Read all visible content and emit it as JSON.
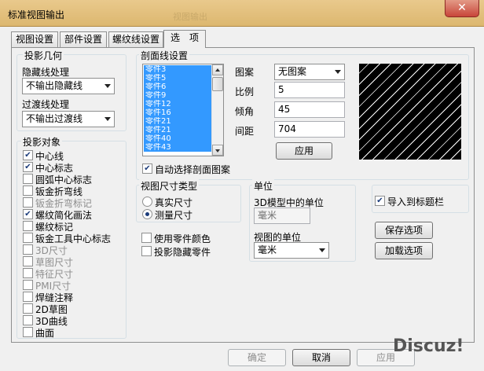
{
  "window": {
    "title": "标准视图输出",
    "ghost_title": "视图输出"
  },
  "tabs": [
    {
      "label": "视图设置"
    },
    {
      "label": "部件设置"
    },
    {
      "label": "螺纹线设置"
    },
    {
      "label": "选　项"
    }
  ],
  "projection_geometry": {
    "title": "投影几何",
    "hidden_label": "隐藏线处理",
    "hidden_value": "不输出隐藏线",
    "transition_label": "过渡线处理",
    "transition_value": "不输出过渡线"
  },
  "projection_objects": {
    "title": "投影对象",
    "items": [
      {
        "label": "中心线",
        "checked": true,
        "enabled": true
      },
      {
        "label": "中心标志",
        "checked": true,
        "enabled": true
      },
      {
        "label": "圆弧中心标志",
        "checked": false,
        "enabled": true
      },
      {
        "label": "钣金折弯线",
        "checked": false,
        "enabled": true
      },
      {
        "label": "钣金折弯标记",
        "checked": false,
        "enabled": false
      },
      {
        "label": "螺纹简化画法",
        "checked": true,
        "enabled": true
      },
      {
        "label": "螺纹标记",
        "checked": false,
        "enabled": true
      },
      {
        "label": "钣金工具中心标志",
        "checked": false,
        "enabled": true
      },
      {
        "label": "3D尺寸",
        "checked": false,
        "enabled": false
      },
      {
        "label": "草图尺寸",
        "checked": false,
        "enabled": false
      },
      {
        "label": "特征尺寸",
        "checked": false,
        "enabled": false
      },
      {
        "label": "PMI尺寸",
        "checked": false,
        "enabled": false
      },
      {
        "label": "焊缝注释",
        "checked": false,
        "enabled": true
      },
      {
        "label": "2D草图",
        "checked": false,
        "enabled": true
      },
      {
        "label": "3D曲线",
        "checked": false,
        "enabled": true
      },
      {
        "label": "曲面",
        "checked": false,
        "enabled": true
      }
    ]
  },
  "section_lines": {
    "title": "剖面线设置",
    "parts": [
      "零件3",
      "零件5",
      "零件6",
      "零件9",
      "零件12",
      "零件16",
      "零件21",
      "零件21",
      "零件40",
      "零件43"
    ],
    "pattern_label": "图案",
    "pattern_value": "无图案",
    "scale_label": "比例",
    "scale_value": "5",
    "angle_label": "倾角",
    "angle_value": "45",
    "spacing_label": "间距",
    "spacing_value": "704",
    "apply_label": "应用",
    "auto_label": "自动选择剖面图案",
    "auto_checked": true
  },
  "dimension_type": {
    "title": "视图尺寸类型",
    "options": [
      {
        "label": "真实尺寸",
        "selected": false
      },
      {
        "label": "测量尺寸",
        "selected": true
      }
    ]
  },
  "units": {
    "title": "单位",
    "model_label": "3D模型中的单位",
    "model_value": "毫米",
    "view_label": "视图的单位",
    "view_value": "毫米"
  },
  "import_title_block": {
    "label": "导入到标题栏",
    "checked": true
  },
  "save_options_label": "保存选项",
  "load_options_label": "加载选项",
  "use_part_color": {
    "label": "使用零件颜色",
    "checked": false
  },
  "project_hidden_parts": {
    "label": "投影隐藏零件",
    "checked": false
  },
  "footer": {
    "ok_label": "确定",
    "cancel_label": "取消",
    "apply_label": "应用"
  },
  "watermark": "Discuz!"
}
